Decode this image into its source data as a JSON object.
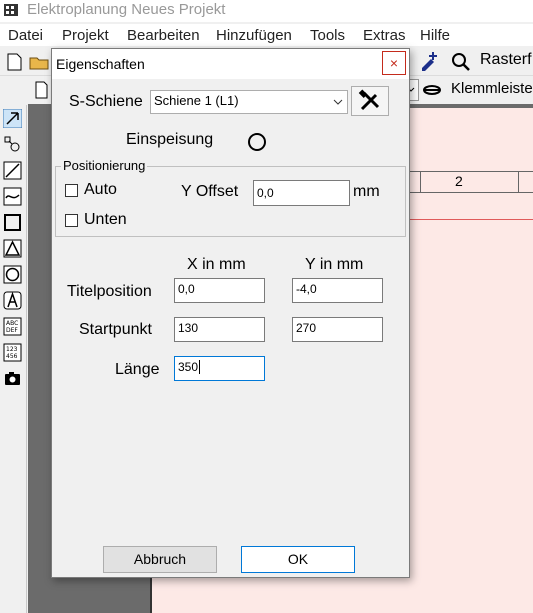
{
  "app": {
    "title": "Elektroplanung Neues Projekt",
    "menu": [
      "Datei",
      "Projekt",
      "Bearbeiten",
      "Hinzufügen",
      "Tools",
      "Extras",
      "Hilfe"
    ],
    "toolbar_right_label": "Rasterf",
    "toolbar2_right_label": "Klemmleiste",
    "sheet_column_label": "2"
  },
  "dialog": {
    "title": "Eigenschaften",
    "close_symbol": "×",
    "s_schiene_label": "S-Schiene",
    "s_schiene_value": "Schiene 1 (L1)",
    "einspeisung_label": "Einspeisung",
    "positionierung": {
      "legend": "Positionierung",
      "auto_label": "Auto",
      "unten_label": "Unten",
      "y_offset_label": "Y Offset",
      "y_offset_value": "0,0",
      "unit": "mm"
    },
    "grid": {
      "x_header": "X in mm",
      "y_header": "Y in mm",
      "titelposition_label": "Titelposition",
      "titelposition_x": "0,0",
      "titelposition_y": "-4,0",
      "startpunkt_label": "Startpunkt",
      "startpunkt_x": "130",
      "startpunkt_y": "270",
      "laenge_label": "Länge",
      "laenge_value": "350"
    },
    "cancel_label": "Abbruch",
    "ok_label": "OK"
  }
}
